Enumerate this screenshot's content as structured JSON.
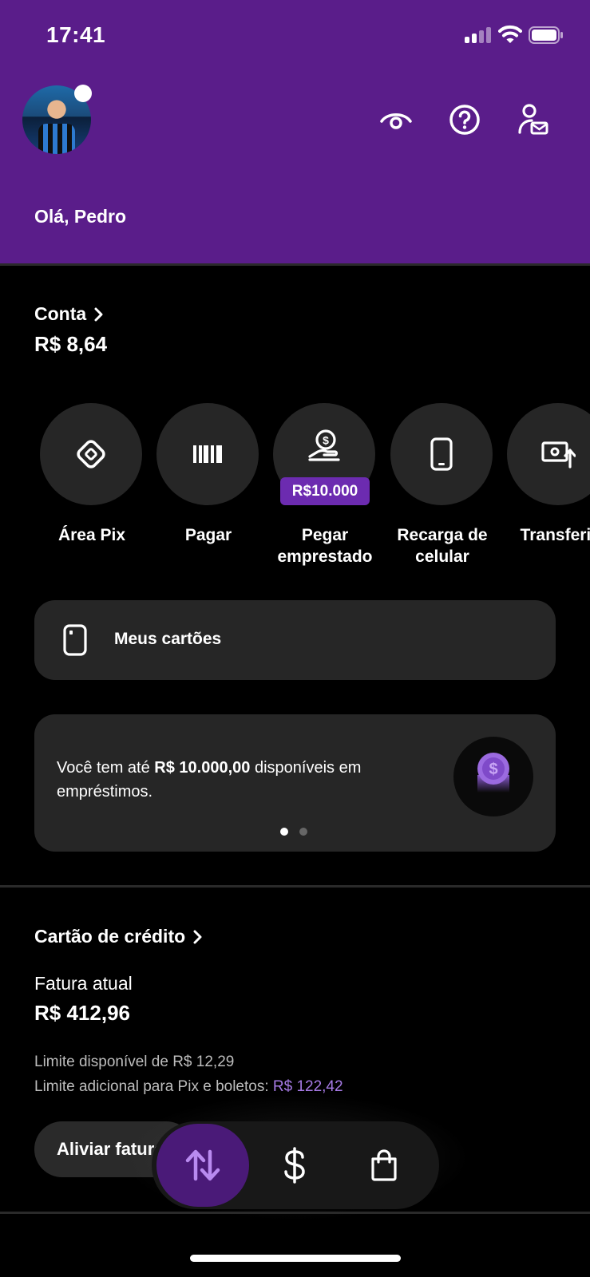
{
  "status_bar": {
    "time": "17:41"
  },
  "header": {
    "greeting": "Olá, Pedro",
    "icons": [
      "eye-icon",
      "help-icon",
      "profile-mail-icon"
    ],
    "background": "#5a1d8a"
  },
  "account": {
    "title": "Conta",
    "balance": "R$ 8,64"
  },
  "shortcuts": [
    {
      "label": "Área Pix",
      "icon": "pix-icon"
    },
    {
      "label": "Pagar",
      "icon": "barcode-icon"
    },
    {
      "label": "Pegar emprestado",
      "icon": "loan-hand-icon",
      "badge": "R$10.000"
    },
    {
      "label": "Recarga de celular",
      "icon": "phone-icon"
    },
    {
      "label": "Transferir",
      "icon": "transfer-icon"
    }
  ],
  "cards_button": {
    "label": "Meus cartões"
  },
  "promo": {
    "text_before": "Você tem até ",
    "text_bold": "R$ 10.000,00",
    "text_after": " disponíveis em empréstimos.",
    "pages": 2,
    "active_page": 1
  },
  "credit_card": {
    "title": "Cartão de crédito",
    "invoice_label": "Fatura atual",
    "invoice_value": "R$ 412,96",
    "limit_available": "Limite disponível de R$ 12,29",
    "limit_extra_label": "Limite adicional para Pix e boletos: ",
    "limit_extra_value": "R$ 122,42",
    "relieve_button": "Aliviar fatura"
  },
  "bottom_nav": {
    "items": [
      "transfer-arrows-icon",
      "dollar-icon",
      "shopping-bag-icon"
    ],
    "active": 0
  },
  "colors": {
    "accent": "#5a1d8a",
    "accent_light": "#a77be6",
    "surface": "#262626"
  }
}
